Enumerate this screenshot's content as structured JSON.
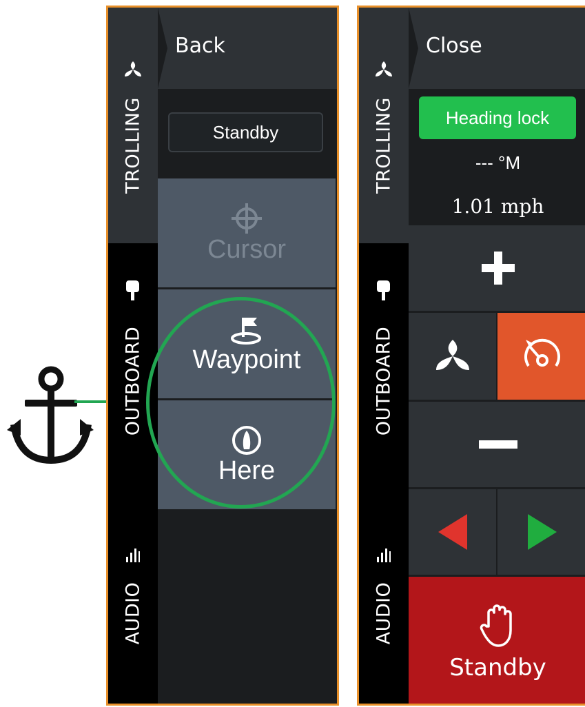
{
  "left_panel": {
    "tabs": [
      {
        "label": "TROLLING",
        "icon": "propeller-icon"
      },
      {
        "label": "OUTBOARD",
        "icon": "outboard-motor-icon"
      },
      {
        "label": "AUDIO",
        "icon": "audio-bars-icon"
      }
    ],
    "back_label": "Back",
    "mode_label": "Standby",
    "menu": [
      {
        "label": "Cursor",
        "icon": "crosshair-icon",
        "enabled": false
      },
      {
        "label": "Waypoint",
        "icon": "flag-waypoint-icon",
        "enabled": true
      },
      {
        "label": "Here",
        "icon": "compass-boat-icon",
        "enabled": true
      }
    ],
    "highlight_color": "#22a652",
    "annotation_icon": "anchor-icon"
  },
  "right_panel": {
    "tabs": [
      {
        "label": "TROLLING",
        "icon": "propeller-icon"
      },
      {
        "label": "OUTBOARD",
        "icon": "outboard-motor-icon"
      },
      {
        "label": "AUDIO",
        "icon": "audio-bars-icon"
      }
    ],
    "close_label": "Close",
    "heading_lock_label": "Heading lock",
    "heading_value": "--- °M",
    "speed_value": "1.01 mph",
    "controls": {
      "plus_icon": "plus-icon",
      "minus_icon": "minus-icon",
      "prop_icon": "propeller-icon",
      "speed_icon": "speedometer-icon",
      "left_icon": "arrow-left-icon",
      "right_icon": "arrow-right-icon"
    },
    "standby_label": "Standby",
    "colors": {
      "accent_orange": "#e1562b",
      "standby_red": "#b3161a",
      "heading_lock_green": "#22bf4e",
      "arrow_left": "#e0342d",
      "arrow_right": "#20ad3f"
    }
  }
}
